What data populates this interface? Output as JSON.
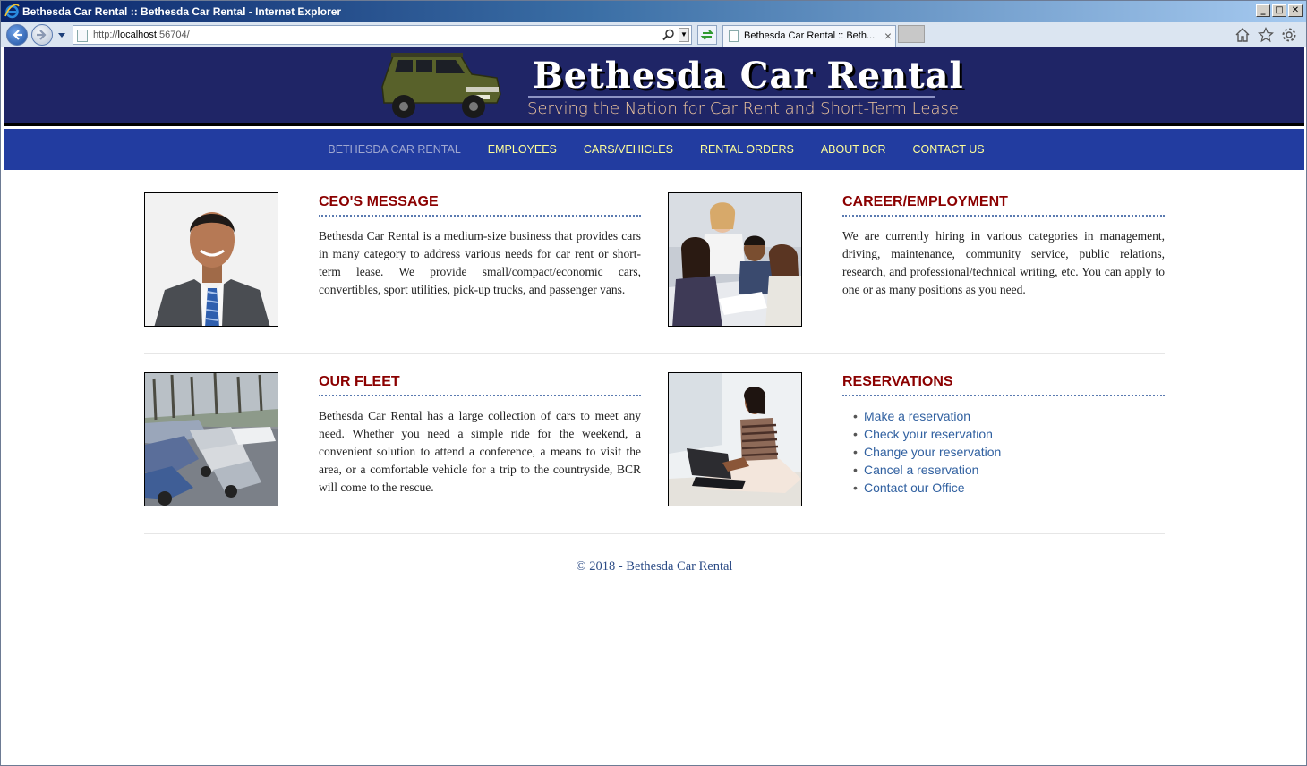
{
  "window": {
    "title": "Bethesda Car Rental :: Bethesda Car Rental - Internet Explorer",
    "minimize": "_",
    "maximize": "□",
    "close": "✕"
  },
  "browser": {
    "url_prefix": "http://",
    "url_host": "localhost",
    "url_rest": ":56704/",
    "tab_title": "Bethesda Car Rental :: Beth...",
    "tab_close": "×"
  },
  "site": {
    "brand": "Bethesda Car Rental",
    "tagline": "Serving the Nation for Car Rent and Short-Term Lease"
  },
  "menu": [
    "BETHESDA CAR RENTAL",
    "EMPLOYEES",
    "CARS/VEHICLES",
    "RENTAL ORDERS",
    "ABOUT BCR",
    "CONTACT US"
  ],
  "sections": {
    "ceo": {
      "heading": "CEO'S MESSAGE",
      "text": "Bethesda Car Rental is a medium-size business that provides cars in many category to address various needs for car rent or short-term lease. We provide small/compact/economic cars, convertibles, sport utilities, pick-up trucks, and passenger vans."
    },
    "career": {
      "heading": "CAREER/EMPLOYMENT",
      "text": "We are currently hiring in various categories in management, driving, maintenance, community service, public relations, research, and professional/technical writing, etc. You can apply to one or as many positions as you need."
    },
    "fleet": {
      "heading": "OUR FLEET",
      "text": "Bethesda Car Rental has a large collection of cars to meet any need. Whether you need a simple ride for the weekend, a convenient solution to attend a conference, a means to visit the area, or a comfortable vehicle for a trip to the countryside, BCR will come to the rescue."
    },
    "reservations": {
      "heading": "RESERVATIONS",
      "links": [
        "Make a reservation",
        "Check your reservation",
        "Change your reservation",
        "Cancel a reservation",
        "Contact our Office"
      ]
    }
  },
  "footer": "© 2018 - Bethesda Car Rental"
}
